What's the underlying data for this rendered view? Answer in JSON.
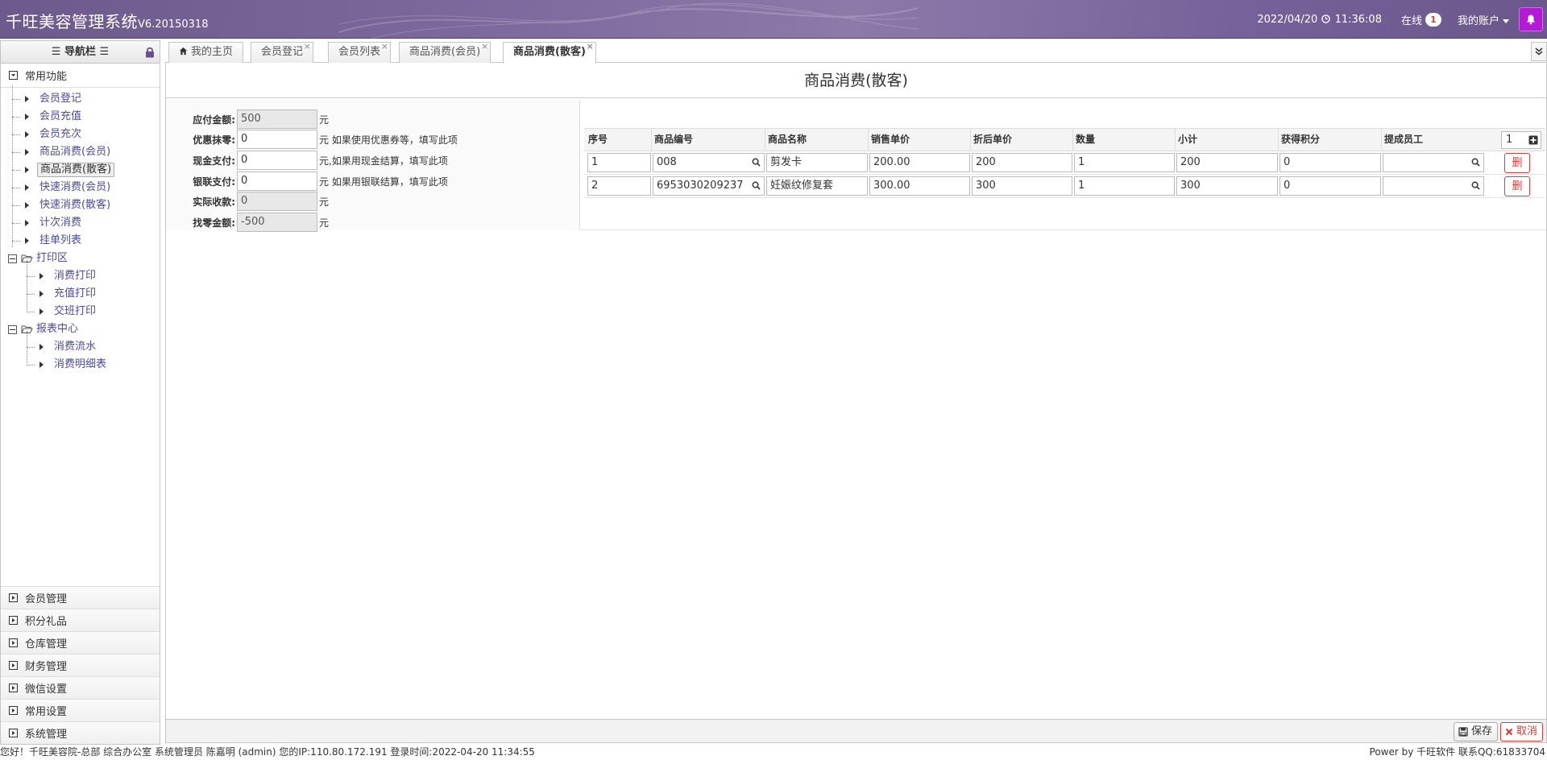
{
  "app": {
    "title": "千旺美容管理系统",
    "version": "V6.20150318"
  },
  "header": {
    "datetime_date": "2022/04/20",
    "datetime_time": "11:36:08",
    "online_label": "在线",
    "online_count": "1",
    "account_label": "我的账户"
  },
  "sidebar": {
    "title": "导航栏",
    "common_label": "常用功能",
    "common_items": [
      {
        "label": "会员登记"
      },
      {
        "label": "会员充值"
      },
      {
        "label": "会员充次"
      },
      {
        "label": "商品消费(会员)"
      },
      {
        "label": "商品消费(散客)",
        "selected": true
      },
      {
        "label": "快速消费(会员)"
      },
      {
        "label": "快速消费(散客)"
      },
      {
        "label": "计次消费"
      },
      {
        "label": "挂单列表"
      }
    ],
    "print_folder": "打印区",
    "print_items": [
      {
        "label": "消费打印"
      },
      {
        "label": "充值打印"
      },
      {
        "label": "交班打印"
      }
    ],
    "report_folder": "报表中心",
    "report_items": [
      {
        "label": "消费流水"
      },
      {
        "label": "消费明细表"
      }
    ],
    "bottom_menus": [
      {
        "label": "会员管理"
      },
      {
        "label": "积分礼品"
      },
      {
        "label": "仓库管理"
      },
      {
        "label": "财务管理"
      },
      {
        "label": "微信设置"
      },
      {
        "label": "常用设置"
      },
      {
        "label": "系统管理"
      }
    ]
  },
  "tabs": [
    {
      "label": "我的主页",
      "closable": false
    },
    {
      "label": "会员登记",
      "closable": true
    },
    {
      "label": "会员列表",
      "closable": true
    },
    {
      "label": "商品消费(会员)",
      "closable": true
    },
    {
      "label": "商品消费(散客)",
      "closable": true,
      "active": true
    }
  ],
  "page": {
    "title": "商品消费(散客)",
    "payment": [
      {
        "label": "应付金额:",
        "value": "500",
        "readonly": true,
        "unit": "元"
      },
      {
        "label": "优惠抹零:",
        "value": "0",
        "readonly": false,
        "unit": "元 如果使用优惠券等，填写此项"
      },
      {
        "label": "现金支付:",
        "value": "0",
        "readonly": false,
        "unit": "元,如果用现金结算，填写此项"
      },
      {
        "label": "银联支付:",
        "value": "0",
        "readonly": false,
        "unit": "元 如果用银联结算，填写此项"
      },
      {
        "label": "实际收款:",
        "value": "0",
        "readonly": true,
        "unit": "元"
      },
      {
        "label": "找零金额:",
        "value": "-500",
        "readonly": true,
        "unit": "元"
      }
    ],
    "table": {
      "columns": [
        "序号",
        "商品编号",
        "商品名称",
        "销售单价",
        "折后单价",
        "数量",
        "小计",
        "获得积分",
        "提成员工"
      ],
      "add_count": "1",
      "delete_label": "删",
      "rows": [
        [
          "1",
          "008",
          "剪发卡",
          "200.00",
          "200",
          "1",
          "200",
          "0",
          ""
        ],
        [
          "2",
          "6953030209237",
          "妊娠纹修复套",
          "300.00",
          "300",
          "1",
          "300",
          "0",
          ""
        ]
      ]
    }
  },
  "toolbar": {
    "save_label": "保存",
    "cancel_label": "取消"
  },
  "statusbar": {
    "left": "您好！千旺美容院-总部 综合办公室 系统管理员 陈嘉明 (admin) 您的IP:110.80.172.191 登录时间:2022-04-20 11:34:55",
    "right": "Power by 千旺软件 联系QQ:61833704"
  },
  "colors": {
    "header_purple": "#7a6799",
    "notify_magenta": "#b21ad3",
    "danger_red": "#d43f3a",
    "link_blue": "#4b4b9b"
  },
  "icons": [
    "clock-icon",
    "bell-icon",
    "caret-down-icon",
    "lock-icon",
    "home-icon",
    "search-icon",
    "plus-icon",
    "save-icon",
    "times-icon",
    "chevron-double-down-icon",
    "folder-open-icon"
  ]
}
